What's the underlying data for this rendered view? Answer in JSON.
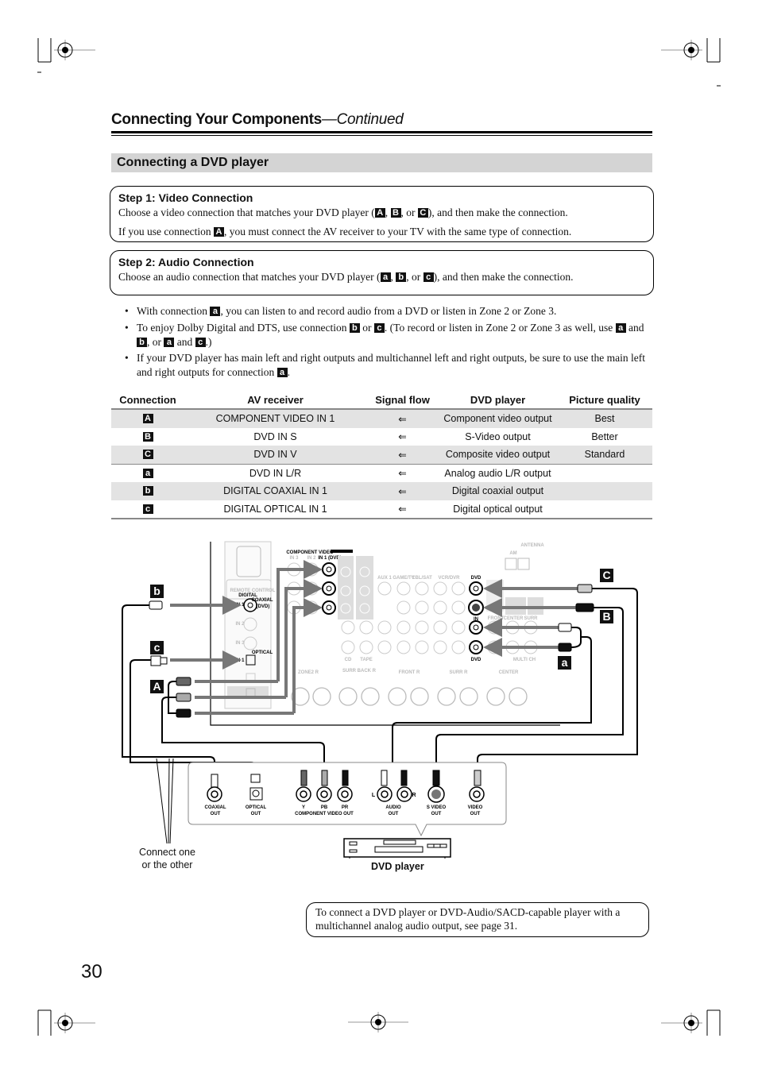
{
  "header": {
    "title": "Connecting Your Components",
    "title_suffix": "—Continued"
  },
  "section": {
    "title": "Connecting a DVD player"
  },
  "step1": {
    "title": "Step 1: Video Connection",
    "line1": {
      "pre": "Choose a video connection that matches your DVD player (",
      "b1": "A",
      "s1": ", ",
      "b2": "B",
      "s2": ", or ",
      "b3": "C",
      "post": "), and then make the connection."
    },
    "line2": {
      "pre": "If you use connection ",
      "b1": "A",
      "post": ", you must connect the AV receiver to your TV with the same type of connection."
    }
  },
  "step2": {
    "title": "Step 2: Audio Connection",
    "line1": {
      "pre": "Choose an audio connection that matches your DVD player (",
      "b1": "a",
      "s1": ", ",
      "b2": "b",
      "s2": ", or ",
      "b3": "c",
      "post": "), and then make the connection."
    }
  },
  "bullets": [
    {
      "pre": "With connection ",
      "b1": "a",
      "post": ", you can listen to and record audio from a DVD or listen in Zone 2 or Zone 3."
    },
    {
      "pre": "To enjoy Dolby Digital and DTS, use connection ",
      "b1": "b",
      "mid1": " or ",
      "b2": "c",
      "mid2": ". (To record or listen in Zone 2 or Zone 3 as well, use ",
      "b3": "a",
      "mid3": " and ",
      "b4": "b",
      "mid4": ", or ",
      "b5": "a",
      "mid5": " and ",
      "b6": "c",
      "post": ".)"
    },
    {
      "pre": "If your DVD player has main left and right outputs and multichannel left and right outputs, be sure to use the main left and right outputs for connection ",
      "b1": "a",
      "post": "."
    }
  ],
  "bullet_char": "•",
  "table": {
    "headers": [
      "Connection",
      "AV receiver",
      "Signal flow",
      "DVD player",
      "Picture quality"
    ],
    "rows": [
      {
        "conn": "A",
        "receiver": "COMPONENT VIDEO IN 1",
        "flow": "⇐",
        "player": "Component video output",
        "quality": "Best"
      },
      {
        "conn": "B",
        "receiver": "DVD IN S",
        "flow": "⇐",
        "player": "S-Video output",
        "quality": "Better"
      },
      {
        "conn": "C",
        "receiver": "DVD IN V",
        "flow": "⇐",
        "player": "Composite video output",
        "quality": "Standard"
      },
      {
        "conn": "a",
        "receiver": "DVD IN L/R",
        "flow": "⇐",
        "player": "Analog audio L/R output",
        "quality": ""
      },
      {
        "conn": "b",
        "receiver": "DIGITAL COAXIAL IN 1",
        "flow": "⇐",
        "player": "Digital coaxial output",
        "quality": ""
      },
      {
        "conn": "c",
        "receiver": "DIGITAL OPTICAL IN 1",
        "flow": "⇐",
        "player": "Digital optical output",
        "quality": ""
      }
    ]
  },
  "diagram": {
    "labels": {
      "b": "b",
      "c": "c",
      "A": "A",
      "C": "C",
      "B": "B",
      "a": "a"
    },
    "receiver": {
      "component_video": "COMPONENT VIDEO",
      "in1_dvd": "IN 1 (DVD)",
      "in2": "IN 2",
      "in3": "IN 3",
      "digital": "DIGITAL",
      "coaxial": "COAXIAL",
      "optical": "OPTICAL",
      "in1": "IN 1",
      "in2d": "IN 2",
      "in3d": "IN 3",
      "dvd_tag": "(DVD)",
      "remote_control": "REMOTE CONTROL",
      "dvd": "DVD",
      "in": "IN",
      "antenna": "ANTENNA",
      "am": "AM",
      "groups": [
        "CD",
        "TAPE",
        "AUX 1",
        "GAME/TV",
        "CBL/SAT",
        "VCR/DVR",
        "DVD",
        "MULTI CH"
      ],
      "speakers": [
        "ZONE2 R",
        "SURR BACK R",
        "FRONT R",
        "SURR R",
        "CENTER"
      ],
      "front_labels": [
        "FRONT",
        "CENTER",
        "SURR"
      ]
    },
    "player_outputs": [
      {
        "top": "COAXIAL",
        "bottom": "OUT"
      },
      {
        "top": "OPTICAL",
        "bottom": "OUT"
      },
      {
        "top": "Y",
        "bottom": ""
      },
      {
        "top": "PB",
        "bottom": ""
      },
      {
        "top": "PR",
        "bottom": ""
      },
      {
        "top": "AUDIO",
        "bottom": "OUT"
      },
      {
        "top": "S VIDEO",
        "bottom": "OUT"
      },
      {
        "top": "VIDEO",
        "bottom": "OUT"
      }
    ],
    "component_video_out": "COMPONENT VIDEO OUT",
    "audio_l": "L",
    "audio_r": "R",
    "connect_note": "Connect one or the other",
    "dvd_player": "DVD player"
  },
  "note": "To connect a DVD player or DVD-Audio/SACD-capable player with a multichannel analog audio output, see page 31.",
  "page_number": "30"
}
